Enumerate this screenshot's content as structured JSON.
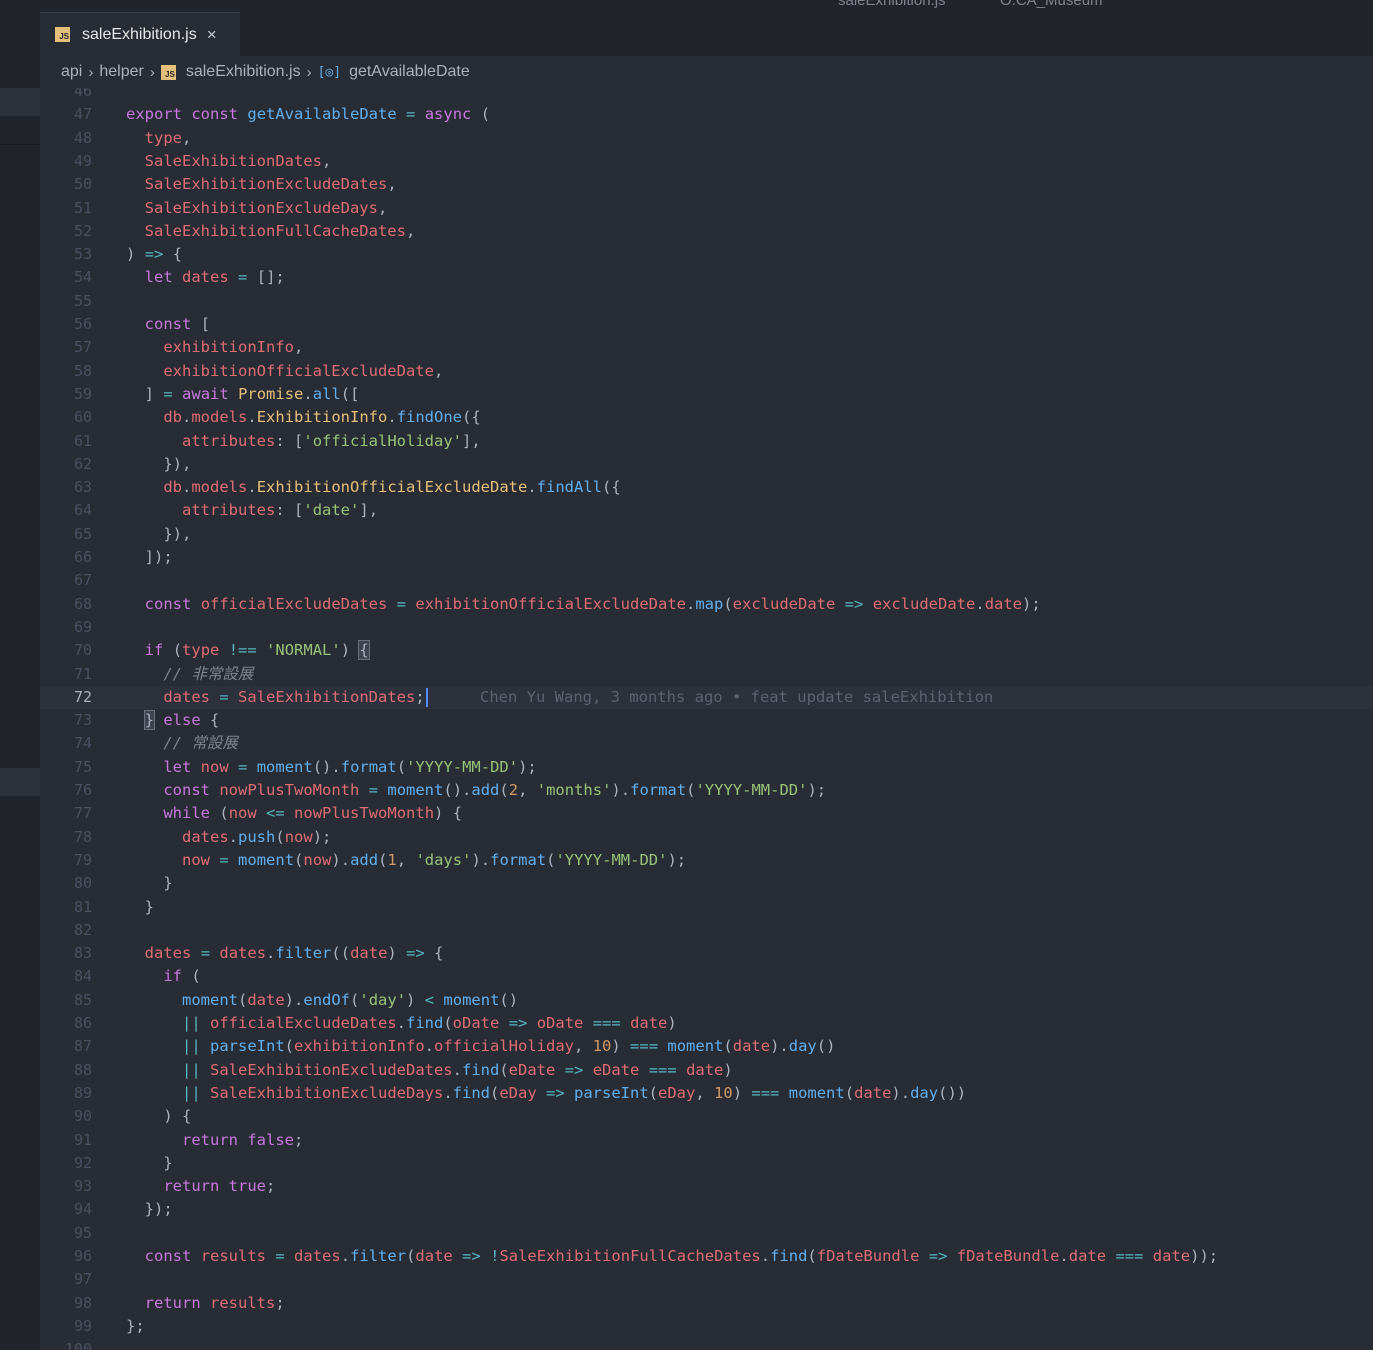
{
  "window": {
    "title_left": "saleExhibition.js",
    "title_right": "O.CA_Museum"
  },
  "tab": {
    "label": "saleExhibition.js",
    "icon_text": "JS",
    "close_glyph": "×"
  },
  "breadcrumb": {
    "items": [
      "api",
      "helper",
      "saleExhibition.js",
      "getAvailableDate"
    ]
  },
  "editor": {
    "current_line": "72",
    "blame": "Chen Yu Wang, 3 months ago • feat update saleExhibition",
    "lines": [
      {
        "n": "46",
        "t": ""
      },
      {
        "n": "47",
        "t": "export const getAvailableDate = async ("
      },
      {
        "n": "48",
        "t": "  type,"
      },
      {
        "n": "49",
        "t": "  SaleExhibitionDates,"
      },
      {
        "n": "50",
        "t": "  SaleExhibitionExcludeDates,"
      },
      {
        "n": "51",
        "t": "  SaleExhibitionExcludeDays,"
      },
      {
        "n": "52",
        "t": "  SaleExhibitionFullCacheDates,"
      },
      {
        "n": "53",
        "t": ") => {"
      },
      {
        "n": "54",
        "t": "  let dates = [];"
      },
      {
        "n": "55",
        "t": ""
      },
      {
        "n": "56",
        "t": "  const ["
      },
      {
        "n": "57",
        "t": "    exhibitionInfo,"
      },
      {
        "n": "58",
        "t": "    exhibitionOfficialExcludeDate,"
      },
      {
        "n": "59",
        "t": "  ] = await Promise.all(["
      },
      {
        "n": "60",
        "t": "    db.models.ExhibitionInfo.findOne({"
      },
      {
        "n": "61",
        "t": "      attributes: ['officialHoliday'],"
      },
      {
        "n": "62",
        "t": "    }),"
      },
      {
        "n": "63",
        "t": "    db.models.ExhibitionOfficialExcludeDate.findAll({"
      },
      {
        "n": "64",
        "t": "      attributes: ['date'],"
      },
      {
        "n": "65",
        "t": "    }),"
      },
      {
        "n": "66",
        "t": "  ]);"
      },
      {
        "n": "67",
        "t": ""
      },
      {
        "n": "68",
        "t": "  const officialExcludeDates = exhibitionOfficialExcludeDate.map(excludeDate => excludeDate.date);"
      },
      {
        "n": "69",
        "t": ""
      },
      {
        "n": "70",
        "t": "  if (type !== 'NORMAL') {"
      },
      {
        "n": "71",
        "t": "    // 非常設展"
      },
      {
        "n": "72",
        "t": "    dates = SaleExhibitionDates;"
      },
      {
        "n": "73",
        "t": "  } else {"
      },
      {
        "n": "74",
        "t": "    // 常設展"
      },
      {
        "n": "75",
        "t": "    let now = moment().format('YYYY-MM-DD');"
      },
      {
        "n": "76",
        "t": "    const nowPlusTwoMonth = moment().add(2, 'months').format('YYYY-MM-DD');"
      },
      {
        "n": "77",
        "t": "    while (now <= nowPlusTwoMonth) {"
      },
      {
        "n": "78",
        "t": "      dates.push(now);"
      },
      {
        "n": "79",
        "t": "      now = moment(now).add(1, 'days').format('YYYY-MM-DD');"
      },
      {
        "n": "80",
        "t": "    }"
      },
      {
        "n": "81",
        "t": "  }"
      },
      {
        "n": "82",
        "t": ""
      },
      {
        "n": "83",
        "t": "  dates = dates.filter((date) => {"
      },
      {
        "n": "84",
        "t": "    if ("
      },
      {
        "n": "85",
        "t": "      moment(date).endOf('day') < moment()"
      },
      {
        "n": "86",
        "t": "      || officialExcludeDates.find(oDate => oDate === date)"
      },
      {
        "n": "87",
        "t": "      || parseInt(exhibitionInfo.officialHoliday, 10) === moment(date).day()"
      },
      {
        "n": "88",
        "t": "      || SaleExhibitionExcludeDates.find(eDate => eDate === date)"
      },
      {
        "n": "89",
        "t": "      || SaleExhibitionExcludeDays.find(eDay => parseInt(eDay, 10) === moment(date).day())"
      },
      {
        "n": "90",
        "t": "    ) {"
      },
      {
        "n": "91",
        "t": "      return false;"
      },
      {
        "n": "92",
        "t": "    }"
      },
      {
        "n": "93",
        "t": "    return true;"
      },
      {
        "n": "94",
        "t": "  });"
      },
      {
        "n": "95",
        "t": ""
      },
      {
        "n": "96",
        "t": "  const results = dates.filter(date => !SaleExhibitionFullCacheDates.find(fDateBundle => fDateBundle.date === date));"
      },
      {
        "n": "97",
        "t": ""
      },
      {
        "n": "98",
        "t": "  return results;"
      },
      {
        "n": "99",
        "t": "};"
      },
      {
        "n": "100",
        "t": ""
      }
    ]
  }
}
